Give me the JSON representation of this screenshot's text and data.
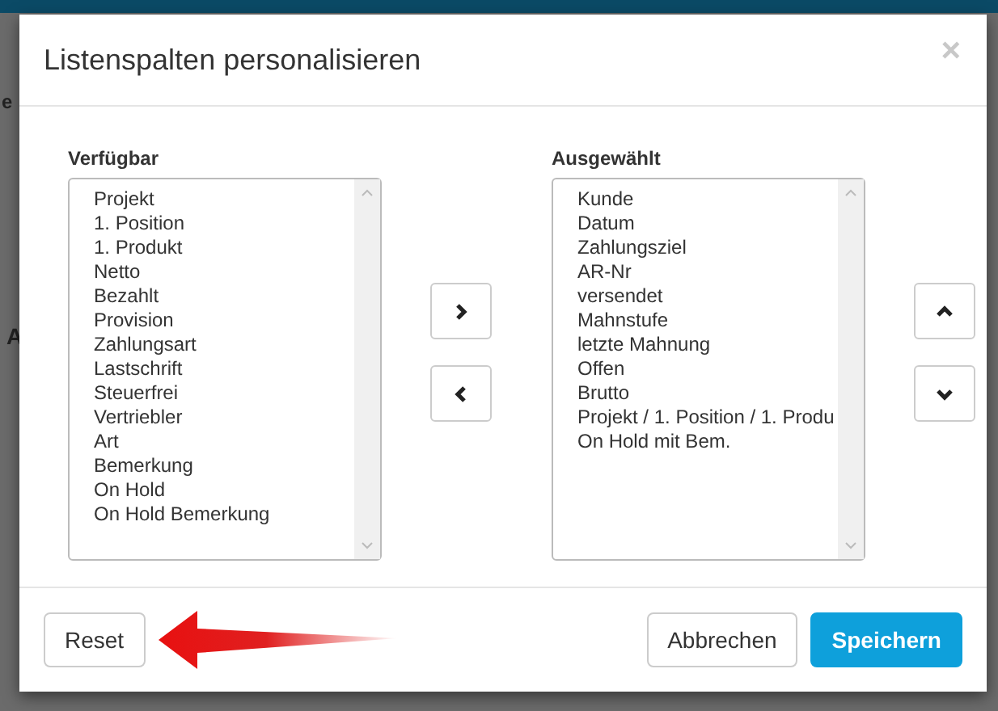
{
  "backdrop": {
    "fragments": [
      "e",
      "A"
    ]
  },
  "dialog": {
    "title": "Listenspalten personalisieren",
    "close": "×",
    "available": {
      "label": "Verfügbar",
      "items": [
        "Projekt",
        "1. Position",
        "1. Produkt",
        "Netto",
        "Bezahlt",
        "Provision",
        "Zahlungsart",
        "Lastschrift",
        "Steuerfrei",
        "Vertriebler",
        "Art",
        "Bemerkung",
        "On Hold",
        "On Hold Bemerkung"
      ]
    },
    "selected": {
      "label": "Ausgewählt",
      "items": [
        "Kunde",
        "Datum",
        "Zahlungsziel",
        "AR-Nr",
        "versendet",
        "Mahnstufe",
        "letzte Mahnung",
        "Offen",
        "Brutto",
        "Projekt / 1. Position / 1. Produ",
        "On Hold mit Bem."
      ]
    },
    "buttons": [
      {
        "label": "Reset",
        "kind": "default"
      },
      {
        "label": "Abbrechen",
        "kind": "default"
      },
      {
        "label": "Speichern",
        "kind": "primary"
      }
    ]
  }
}
